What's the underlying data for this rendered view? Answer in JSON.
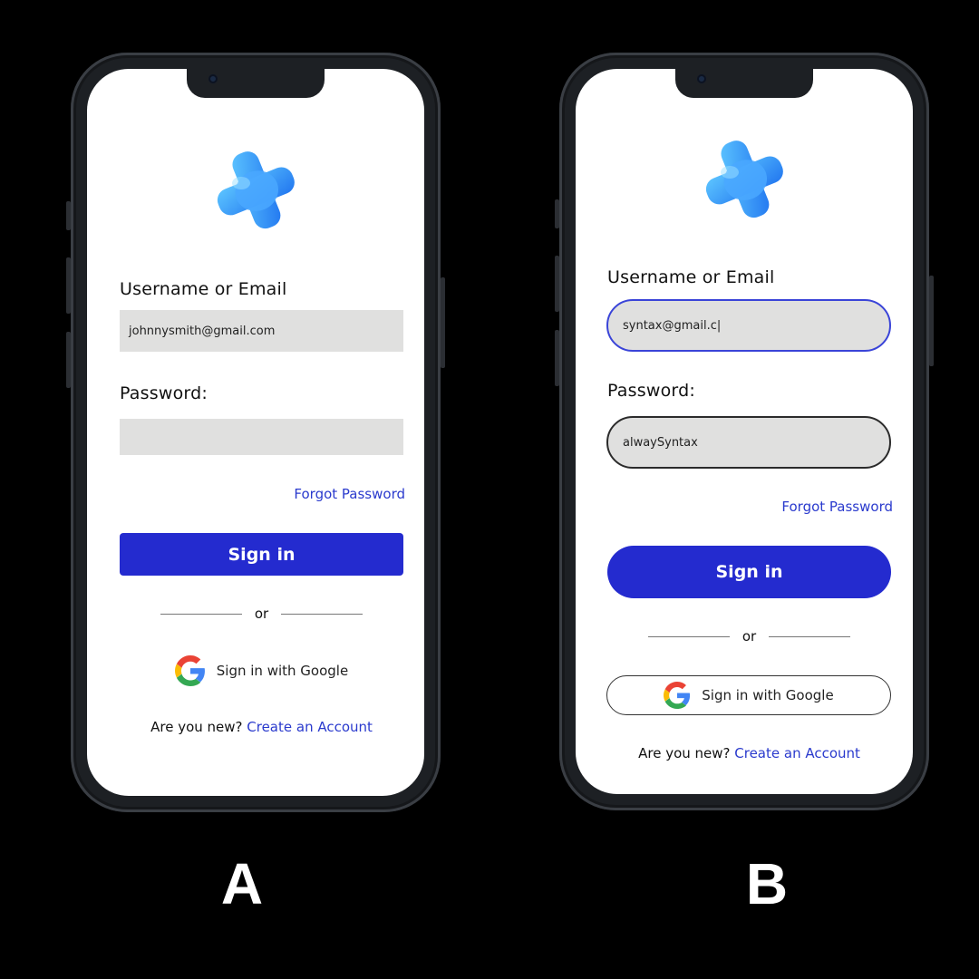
{
  "phone_a": {
    "username_label": "Username or Email",
    "username_value": "johnnysmith@gmail.com",
    "password_label": "Password:",
    "password_value": "",
    "forgot_label": "Forgot Password",
    "signin_label": "Sign in",
    "or_label": "or",
    "google_label": "Sign in with Google",
    "new_prompt": "Are you new?",
    "create_label": "Create an Account",
    "caption": "A"
  },
  "phone_b": {
    "username_label": "Username or Email",
    "username_value": "syntax@gmail.c|",
    "password_label": "Password:",
    "password_value": "alwaySyntax",
    "forgot_label": "Forgot Password",
    "signin_label": "Sign in",
    "or_label": "or",
    "google_label": "Sign in with Google",
    "new_prompt": "Are you new?",
    "create_label": "Create an Account",
    "caption": "B"
  },
  "icons": [
    "logo-icon",
    "google-icon",
    "camera-icon"
  ],
  "colors": {
    "background": "#000000",
    "primary": "#242bcf",
    "link": "#2a3acd",
    "field": "#e0e0df",
    "logo": "#3d9bff"
  }
}
